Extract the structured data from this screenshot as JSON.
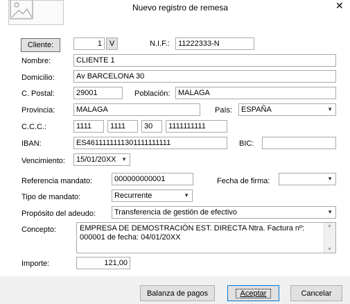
{
  "window": {
    "title": "Nuevo registro de remesa",
    "close": "✕"
  },
  "labels": {
    "nif": "N.I.F.:",
    "nombre": "Nombre:",
    "domicilio": "Domicilio:",
    "cpostal": "C. Postal:",
    "poblacion": "Población:",
    "provincia": "Provincia:",
    "pais": "País:",
    "ccc": "C.C.C.:",
    "iban": "IBAN:",
    "bic": "BIC:",
    "vencimiento": "Vencimiento:",
    "ref_mandato": "Referencia mandato:",
    "fecha_firma": "Fecha de firma:",
    "tipo_mandato": "Tipo de mandato:",
    "proposito": "Propósito del adeudo:",
    "concepto": "Concepto:",
    "importe": "Importe:"
  },
  "buttons": {
    "cliente": "Cliente:",
    "v": "V",
    "balanza": "Balanza de pagos",
    "aceptar": "Aceptar",
    "cancelar": "Cancelar"
  },
  "values": {
    "cliente_num": "1",
    "nif": "11222333-N",
    "nombre": "CLIENTE 1",
    "domicilio": "Av BARCELONA 30",
    "cpostal": "29001",
    "poblacion": "MALAGA",
    "provincia": "MALAGA",
    "pais": "ESPAÑA",
    "ccc_entidad": "1111",
    "ccc_oficina": "1111",
    "ccc_dc": "30",
    "ccc_cuenta": "1111111111",
    "iban": "ES4611111111301111111111",
    "bic": "",
    "vencimiento": "15/01/20XX",
    "ref_mandato": "000000000001",
    "fecha_firma": "",
    "tipo_mandato": "Recurrente",
    "proposito": "Transferencia de gestión de efectivo",
    "concepto": "EMPRESA DE DEMOSTRACIÓN EST. DIRECTA Ntra. Factura nº: 000001 de fecha: 04/01/20XX",
    "importe": "121,00"
  }
}
